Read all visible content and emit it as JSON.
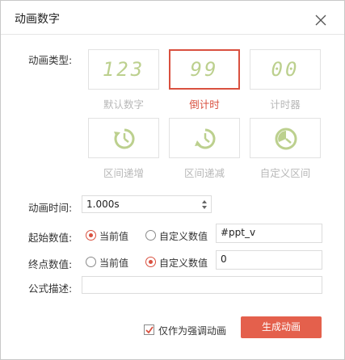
{
  "dialog": {
    "title": "动画数字",
    "close_icon": "close-icon"
  },
  "animation_type": {
    "label": "动画类型:",
    "options": [
      {
        "display": "123",
        "caption": "默认数字",
        "selected": false
      },
      {
        "display": "99",
        "caption": "倒计时",
        "selected": true
      },
      {
        "display": "00",
        "caption": "计时器",
        "selected": false
      },
      {
        "icon": "clock-arrow-up-icon",
        "caption": "区间递增",
        "selected": false
      },
      {
        "icon": "clock-arrow-down-icon",
        "caption": "区间递减",
        "selected": false
      },
      {
        "icon": "clock-custom-icon",
        "caption": "自定义区间",
        "selected": false
      }
    ]
  },
  "duration": {
    "label": "动画时间:",
    "value": "1.000s"
  },
  "start_value": {
    "label": "起始数值:",
    "option_current": "当前值",
    "option_custom": "自定义数值",
    "selected": "current",
    "custom_value": "#ppt_v"
  },
  "end_value": {
    "label": "终点数值:",
    "option_current": "当前值",
    "option_custom": "自定义数值",
    "selected": "custom",
    "custom_value": "0"
  },
  "formula": {
    "label": "公式描述:",
    "value": ""
  },
  "emphasis_checkbox": {
    "label": "仅作为强调动画",
    "checked": true
  },
  "generate_button": {
    "label": "生成动画"
  },
  "colors": {
    "accent": "#d9503f",
    "button": "#e4604c",
    "digit": "#bcd08e",
    "disabled_text": "#b8b8b8"
  }
}
